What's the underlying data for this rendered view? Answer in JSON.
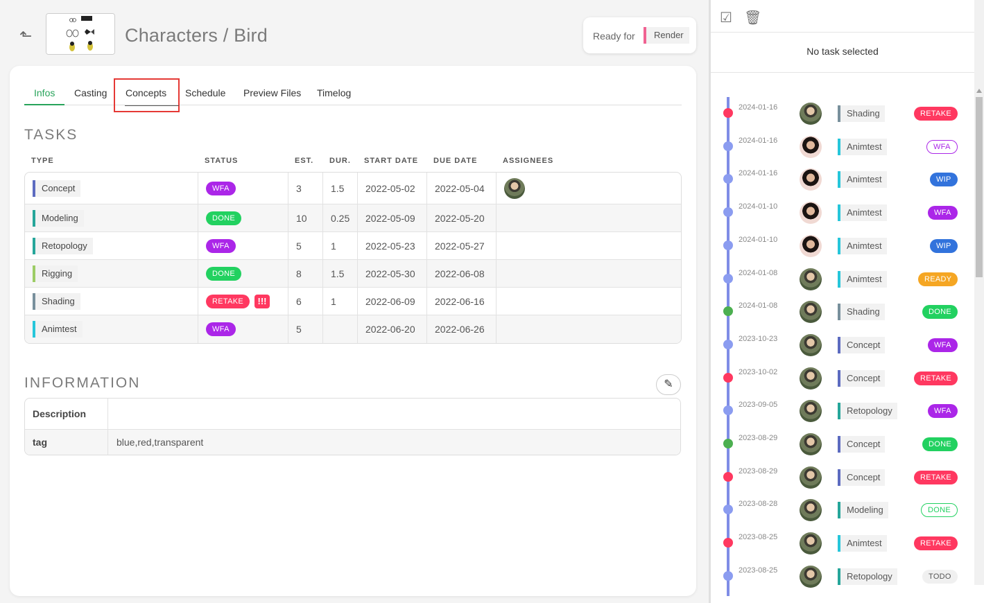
{
  "header": {
    "back_icon": "arrow-up-left-icon",
    "title": "Characters / Bird",
    "ready_label": "Ready for",
    "ready_value": "Render",
    "ready_color": "#f06292"
  },
  "tabs": [
    {
      "label": "Infos",
      "active": true
    },
    {
      "label": "Casting"
    },
    {
      "label": "Concepts",
      "highlighted": true
    },
    {
      "label": "Schedule"
    },
    {
      "label": "Preview Files"
    },
    {
      "label": "Timelog"
    }
  ],
  "tasks": {
    "title": "TASKS",
    "columns": [
      "TYPE",
      "STATUS",
      "EST.",
      "DUR.",
      "START DATE",
      "DUE DATE",
      "ASSIGNEES"
    ],
    "rows": [
      {
        "type": "Concept",
        "type_color": "#5c6bc0",
        "status": "WFA",
        "status_color": "#ab26e8",
        "est": "3",
        "dur": "1.5",
        "start": "2022-05-02",
        "due": "2022-05-04",
        "assignee": true
      },
      {
        "type": "Modeling",
        "type_color": "#26a69a",
        "status": "DONE",
        "status_color": "#22d160",
        "est": "10",
        "dur": "0.25",
        "start": "2022-05-09",
        "due": "2022-05-20",
        "assignee": false
      },
      {
        "type": "Retopology",
        "type_color": "#26a69a",
        "status": "WFA",
        "status_color": "#ab26e8",
        "est": "5",
        "dur": "1",
        "start": "2022-05-23",
        "due": "2022-05-27",
        "assignee": false
      },
      {
        "type": "Rigging",
        "type_color": "#9ccc65",
        "status": "DONE",
        "status_color": "#22d160",
        "est": "8",
        "dur": "1.5",
        "start": "2022-05-30",
        "due": "2022-06-08",
        "assignee": false
      },
      {
        "type": "Shading",
        "type_color": "#78909c",
        "status": "RETAKE",
        "status_color": "#ff3860",
        "priority": "!!!",
        "est": "6",
        "dur": "1",
        "start": "2022-06-09",
        "due": "2022-06-16",
        "assignee": false
      },
      {
        "type": "Animtest",
        "type_color": "#26c6da",
        "status": "WFA",
        "status_color": "#ab26e8",
        "est": "5",
        "dur": "",
        "start": "2022-06-20",
        "due": "2022-06-26",
        "assignee": false
      }
    ]
  },
  "information": {
    "title": "INFORMATION",
    "edit_icon": "edit-icon",
    "rows": [
      {
        "key": "Description",
        "value": ""
      },
      {
        "key": "tag",
        "value": "blue,red,transparent"
      }
    ]
  },
  "side_panel": {
    "tools": [
      "checkbox-icon",
      "trash-icon"
    ],
    "no_task": "No task selected",
    "timeline": [
      {
        "date": "2024-01-16",
        "dot": "#ff3860",
        "avatar": "a",
        "type": "Shading",
        "type_color": "#78909c",
        "status": "RETAKE",
        "status_color": "#ff3860",
        "outline": false
      },
      {
        "date": "2024-01-16",
        "dot": "#8b9cf0",
        "avatar": "b",
        "type": "Animtest",
        "type_color": "#26c6da",
        "status": "WFA",
        "status_color": "#ab26e8",
        "outline": true
      },
      {
        "date": "2024-01-16",
        "dot": "#8b9cf0",
        "avatar": "b",
        "type": "Animtest",
        "type_color": "#26c6da",
        "status": "WIP",
        "status_color": "#3273dc",
        "outline": false
      },
      {
        "date": "2024-01-10",
        "dot": "#8b9cf0",
        "avatar": "b",
        "type": "Animtest",
        "type_color": "#26c6da",
        "status": "WFA",
        "status_color": "#ab26e8",
        "outline": false
      },
      {
        "date": "2024-01-10",
        "dot": "#8b9cf0",
        "avatar": "b",
        "type": "Animtest",
        "type_color": "#26c6da",
        "status": "WIP",
        "status_color": "#3273dc",
        "outline": false
      },
      {
        "date": "2024-01-08",
        "dot": "#8b9cf0",
        "avatar": "a",
        "type": "Animtest",
        "type_color": "#26c6da",
        "status": "READY",
        "status_color": "#f5a623",
        "outline": false
      },
      {
        "date": "2024-01-08",
        "dot": "#4caf50",
        "avatar": "a",
        "type": "Shading",
        "type_color": "#78909c",
        "status": "DONE",
        "status_color": "#22d160",
        "outline": false
      },
      {
        "date": "2023-10-23",
        "dot": "#8b9cf0",
        "avatar": "a",
        "type": "Concept",
        "type_color": "#5c6bc0",
        "status": "WFA",
        "status_color": "#ab26e8",
        "outline": false
      },
      {
        "date": "2023-10-02",
        "dot": "#ff3860",
        "avatar": "a",
        "type": "Concept",
        "type_color": "#5c6bc0",
        "status": "RETAKE",
        "status_color": "#ff3860",
        "outline": false
      },
      {
        "date": "2023-09-05",
        "dot": "#8b9cf0",
        "avatar": "a",
        "type": "Retopology",
        "type_color": "#26a69a",
        "status": "WFA",
        "status_color": "#ab26e8",
        "outline": false
      },
      {
        "date": "2023-08-29",
        "dot": "#4caf50",
        "avatar": "a",
        "type": "Concept",
        "type_color": "#5c6bc0",
        "status": "DONE",
        "status_color": "#22d160",
        "outline": false
      },
      {
        "date": "2023-08-29",
        "dot": "#ff3860",
        "avatar": "a",
        "type": "Concept",
        "type_color": "#5c6bc0",
        "status": "RETAKE",
        "status_color": "#ff3860",
        "outline": false
      },
      {
        "date": "2023-08-28",
        "dot": "#8b9cf0",
        "avatar": "a",
        "type": "Modeling",
        "type_color": "#26a69a",
        "status": "DONE",
        "status_color": "#22d160",
        "outline": true
      },
      {
        "date": "2023-08-25",
        "dot": "#ff3860",
        "avatar": "a",
        "type": "Animtest",
        "type_color": "#26c6da",
        "status": "RETAKE",
        "status_color": "#ff3860",
        "outline": false
      },
      {
        "date": "2023-08-25",
        "dot": "#8b9cf0",
        "avatar": "a",
        "type": "Retopology",
        "type_color": "#26a69a",
        "status": "TODO",
        "status_color": "#f0f0f0",
        "outline": false
      }
    ]
  }
}
